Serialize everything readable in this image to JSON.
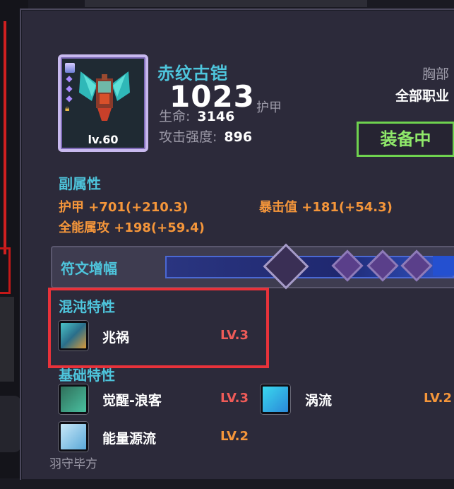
{
  "item": {
    "name": "赤纹古铠",
    "level": "lv.60",
    "armor_value": "1023",
    "armor_unit": "护甲",
    "stats": [
      {
        "label": "生命:",
        "value": "3146"
      },
      {
        "label": "攻击强度:",
        "value": "896"
      }
    ],
    "slot": "胸部",
    "job": "全部职业",
    "equipped_label": "装备中"
  },
  "secondary": {
    "title": "副属性",
    "lines": [
      "护甲 +701(+210.3)",
      "暴击值 +181(+54.3)",
      "全能属攻 +198(+59.4)"
    ]
  },
  "rune": {
    "label": "符文增幅"
  },
  "chaos": {
    "title": "混沌特性",
    "skill": {
      "name": "兆祸",
      "level": "LV.3"
    }
  },
  "basic": {
    "title": "基础特性",
    "skills": [
      {
        "name": "觉醒-浪客",
        "level": "LV.3"
      },
      {
        "name": "涡流",
        "level": "LV.2"
      },
      {
        "name": "能量源流",
        "level": "LV.2"
      }
    ]
  },
  "footer": "羽守毕方",
  "colors": {
    "accent": "#4ec5dc",
    "attribute": "#f5963a",
    "level_red": "#ef5b58",
    "equipped": "#6fd24f",
    "highlight": "#e8323a"
  }
}
